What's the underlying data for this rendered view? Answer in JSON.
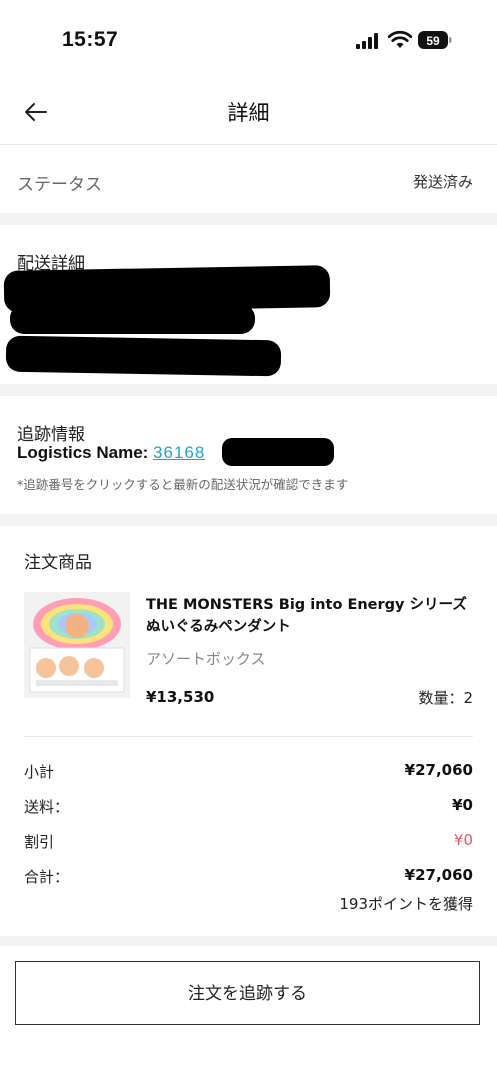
{
  "status_bar": {
    "time": "15:57",
    "battery": "59"
  },
  "nav": {
    "title": "詳細"
  },
  "status_section": {
    "label": "ステータス",
    "value": "発送済み"
  },
  "shipping_section": {
    "title": "配送詳細"
  },
  "tracking_section": {
    "title": "追跡情報",
    "logistics_label": "Logistics Name: ",
    "tracking_number_visible": "36168",
    "note": "*追跡番号をクリックすると最新の配送状況が確認できます"
  },
  "order_section": {
    "title": "注文商品",
    "product": {
      "name": "THE MONSTERS Big into Energy シリーズ ぬいぐるみペンダント",
      "variant": "アソートボックス",
      "price": "¥13,530",
      "quantity": "数量：2"
    },
    "summary": [
      {
        "label": "小計",
        "value": "¥27,060"
      },
      {
        "label": "送料：",
        "value": "¥0"
      },
      {
        "label": "割引",
        "value": "¥0"
      },
      {
        "label": "合計：",
        "value": "¥27,060"
      }
    ],
    "points": "193ポイントを獲得"
  },
  "track_button": {
    "label": "注文を追跡する"
  },
  "colors": {
    "link": "#1fa4c9",
    "discount": "#e05868",
    "section_gap": "#f3f3f3"
  }
}
